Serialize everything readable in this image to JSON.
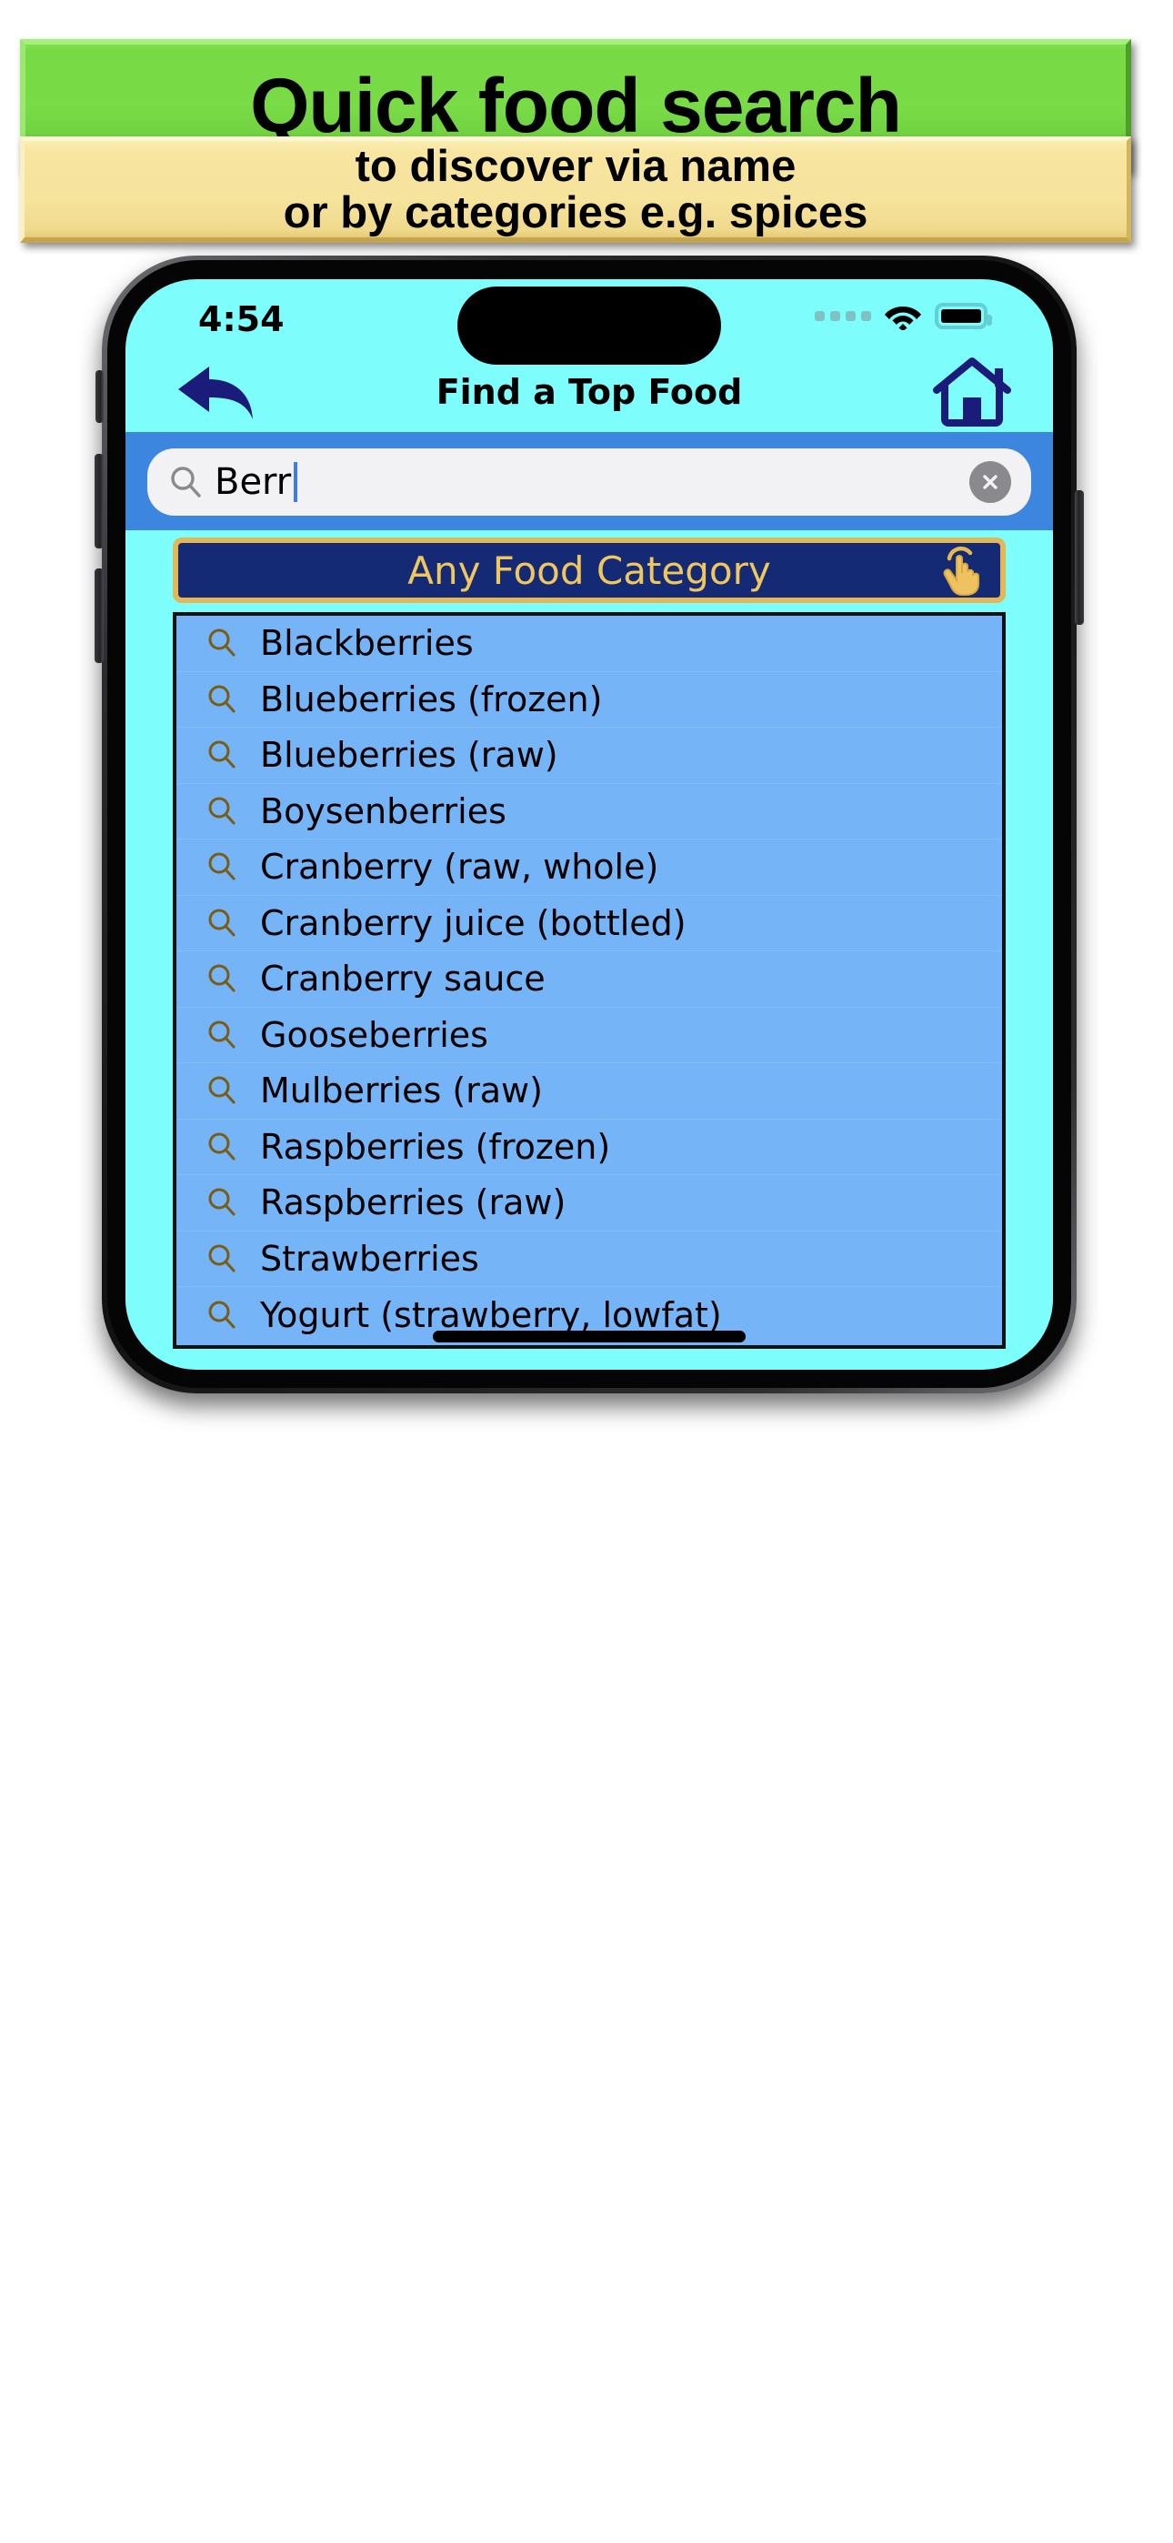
{
  "promo": {
    "headline": "Quick food search",
    "subline_1": "to discover via name",
    "subline_2": "or by categories e.g. spices",
    "headline_bg": "#79dc47",
    "subline_bg": "#f6e49d"
  },
  "status_bar": {
    "time": "4:54",
    "signal_icon": "signal-dots-icon",
    "wifi_icon": "wifi-icon",
    "battery_icon": "battery-full-icon"
  },
  "nav": {
    "title": "Find a Top Food",
    "back_icon": "back-arrow-icon",
    "home_icon": "home-icon",
    "accent": "#1b1b7a"
  },
  "search": {
    "value": "Berr",
    "placeholder": "Search",
    "search_icon": "search-icon",
    "clear_icon": "clear-circle-icon",
    "bar_bg": "#3d86e0"
  },
  "category": {
    "label": "Any Food Category",
    "tap_icon": "tap-hand-icon",
    "bg": "#152a74",
    "border": "#e3b657",
    "text_color": "#f0c75e"
  },
  "results": {
    "row_icon": "search-icon",
    "items": [
      "Blackberries",
      "Blueberries (frozen)",
      "Blueberries (raw)",
      "Boysenberries",
      "Cranberry (raw, whole)",
      "Cranberry juice (bottled)",
      "Cranberry sauce",
      "Gooseberries",
      "Mulberries (raw)",
      "Raspberries (frozen)",
      "Raspberries (raw)",
      "Strawberries",
      "Yogurt (strawberry, lowfat)"
    ]
  },
  "device": {
    "home_indicator": "home-indicator",
    "screen_bg": "#7efdfd"
  }
}
